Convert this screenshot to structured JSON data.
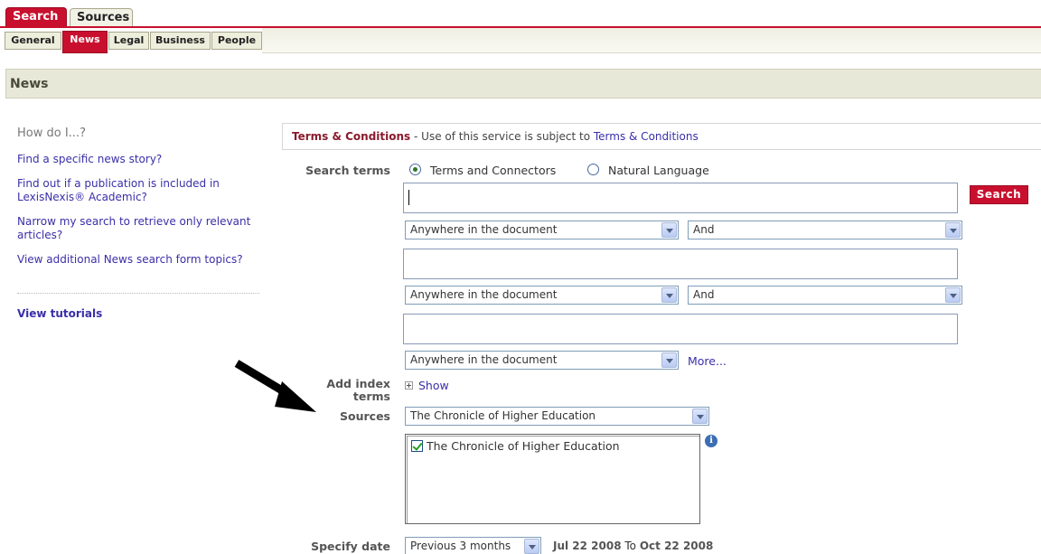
{
  "top_tabs": [
    {
      "label": "Search",
      "active": true
    },
    {
      "label": "Sources",
      "active": false
    }
  ],
  "sub_tabs": [
    {
      "label": "General",
      "active": false
    },
    {
      "label": "News",
      "active": true
    },
    {
      "label": "Legal",
      "active": false
    },
    {
      "label": "Business",
      "active": false
    },
    {
      "label": "People",
      "active": false
    }
  ],
  "page_title": "News",
  "sidebar": {
    "heading": "How do I...?",
    "links": [
      "Find a specific news story?",
      "Find out if a publication is included in LexisNexis® Academic?",
      "Narrow my search to retrieve only relevant articles?",
      "View additional News search form topics?"
    ],
    "tutorials": "View tutorials"
  },
  "terms": {
    "title": "Terms & Conditions",
    "text": " - Use of this service is subject to ",
    "link": "Terms & Conditions"
  },
  "form": {
    "search_terms_label": "Search terms",
    "radio_terms_connectors": "Terms and Connectors",
    "radio_natural_language": "Natural Language",
    "search_button": "Search",
    "field_location": "Anywhere in the document",
    "connector": "And",
    "more_link": "More...",
    "index_label_line1": "Add index",
    "index_label_line2": "terms",
    "show_link": "Show",
    "sources_label": "Sources",
    "sources_selected": "The Chronicle of Higher Education",
    "sources_checked_item": "The Chronicle of Higher Education",
    "info_glyph": "i",
    "date_label": "Specify date",
    "date_option": "Previous 3 months",
    "date_from": "Jul 22 2008",
    "date_to_word": " To ",
    "date_to": "Oct 22 2008"
  },
  "colors": {
    "brand_red": "#c8102e",
    "link_blue": "#3a2fa8",
    "header_beige": "#e8e8d8"
  }
}
